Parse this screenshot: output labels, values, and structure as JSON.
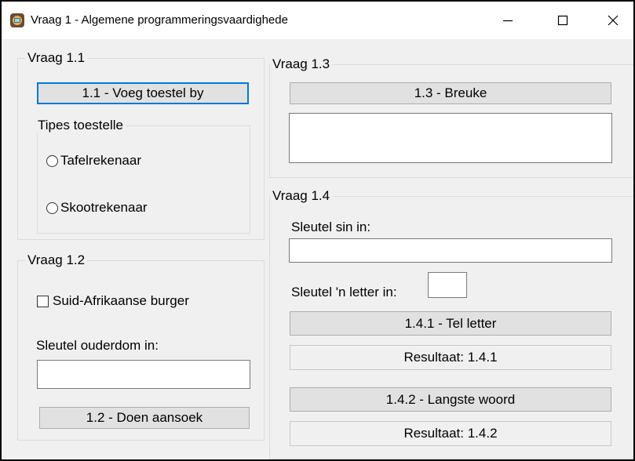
{
  "window": {
    "title": "Vraag 1 - Algemene programmeringsvaardighede",
    "controls": {
      "minimize": "minimize-icon",
      "maximize": "maximize-icon",
      "close": "close-icon"
    }
  },
  "vraag_1_1": {
    "title": "Vraag 1.1",
    "button": "1.1 - Voeg toestel by",
    "tipes": {
      "title": "Tipes toestelle",
      "options": [
        "Tafelrekenaar",
        "Skootrekenaar"
      ]
    }
  },
  "vraag_1_2": {
    "title": "Vraag 1.2",
    "checkbox": "Suid-Afrikaanse burger",
    "age_label": "Sleutel ouderdom in:",
    "age_value": "",
    "button": "1.2 - Doen aansoek"
  },
  "vraag_1_3": {
    "title": "Vraag 1.3",
    "button": "1.3 - Breuke",
    "output": ""
  },
  "vraag_1_4": {
    "title": "Vraag 1.4",
    "sentence_label": "Sleutel sin in:",
    "sentence_value": "",
    "letter_label": "Sleutel 'n letter in:",
    "letter_value": "",
    "count_button": "1.4.1 - Tel letter",
    "result_1": "Resultaat: 1.4.1",
    "longest_button": "1.4.2 - Langste woord",
    "result_2": "Resultaat: 1.4.2"
  },
  "colors": {
    "focus_border": "#0078d7",
    "button_face": "#e1e1e1",
    "window_bg": "#f0f0f0"
  }
}
